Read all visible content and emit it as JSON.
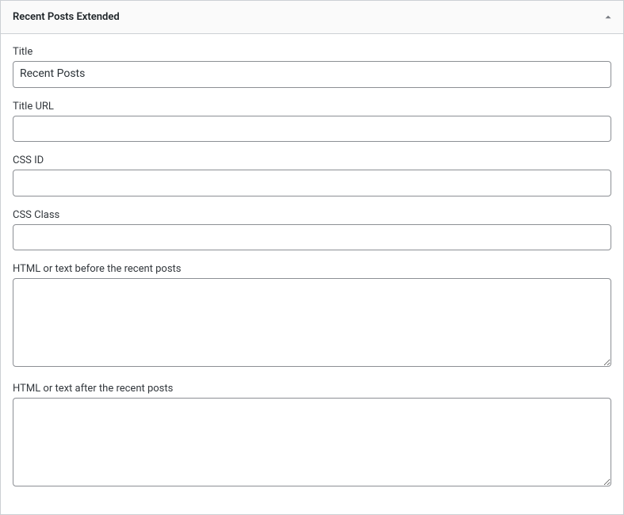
{
  "widget": {
    "header": {
      "title": "Recent Posts Extended"
    },
    "fields": {
      "title": {
        "label": "Title",
        "value": "Recent Posts"
      },
      "title_url": {
        "label": "Title URL",
        "value": ""
      },
      "css_id": {
        "label": "CSS ID",
        "value": ""
      },
      "css_class": {
        "label": "CSS Class",
        "value": ""
      },
      "before_html": {
        "label": "HTML or text before the recent posts",
        "value": ""
      },
      "after_html": {
        "label": "HTML or text after the recent posts",
        "value": ""
      }
    }
  }
}
